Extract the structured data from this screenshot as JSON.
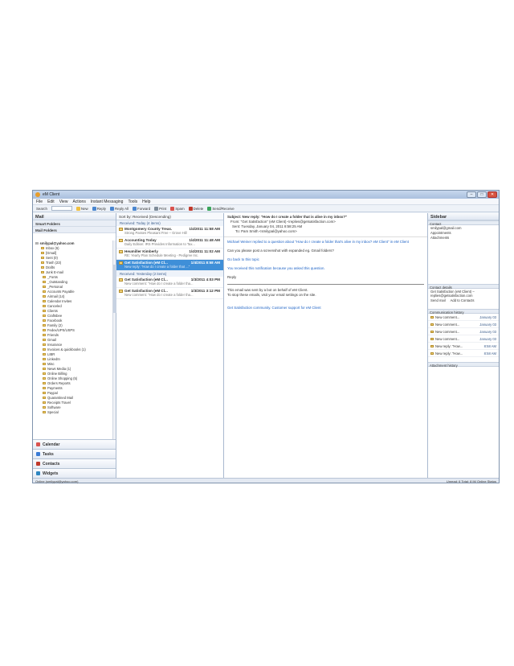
{
  "window": {
    "title": "eM Client"
  },
  "menu": [
    "File",
    "Edit",
    "View",
    "Actions",
    "Instant Messaging",
    "Tools",
    "Help"
  ],
  "toolbar": {
    "search_label": "Search",
    "buttons": [
      {
        "label": "New",
        "icon": "new-icon"
      },
      {
        "label": "Reply",
        "icon": "reply-icon"
      },
      {
        "label": "Reply All",
        "icon": "reply-all-icon"
      },
      {
        "label": "Forward",
        "icon": "forward-icon"
      },
      {
        "label": "Print",
        "icon": "print-icon"
      },
      {
        "label": "Spam",
        "icon": "spam-icon"
      },
      {
        "label": "Delete",
        "icon": "delete-icon"
      },
      {
        "label": "Send/Receive",
        "icon": "send-receive-icon"
      }
    ]
  },
  "nav": {
    "header": "Mail",
    "section_smart": "Smart Folders",
    "section_mail": "Mail Folders",
    "account": "smilypal@yahoo.com",
    "folders": [
      "Inbox (6)",
      "[Gmail]",
      "Sent (0)",
      "Trash (23)",
      "Drafts",
      "Junk E-mail",
      "_Fonts",
      "_Outstanding",
      "_Personal",
      "Accounts Payable",
      "Airmail (14)",
      "Calendar Invites",
      "Canceled",
      "Clients",
      "Craftsbee",
      "Facebook",
      "Family (2)",
      "Fedex/UPS/USPS",
      "Friends",
      "Gmail",
      "Insurance",
      "Invoices & quickbooks (1)",
      "LIBR",
      "LinkedIn",
      "Misc",
      "News Media (1)",
      "Online Billing",
      "Online Shopping (5)",
      "Orders Reports",
      "Payments",
      "Paypal",
      "Quarantined Mail",
      "Receipts Travel",
      "Software",
      "Special"
    ],
    "bottom_buttons": [
      {
        "label": "Calendar",
        "color": "#d9534f"
      },
      {
        "label": "Tasks",
        "color": "#3a7bd5"
      },
      {
        "label": "Contacts",
        "color": "#c0392b"
      },
      {
        "label": "Widgets",
        "color": "#2e86c1"
      }
    ]
  },
  "list": {
    "sort_label": "Sort by: Received (Descending)",
    "group1": "Received: Today (4 items)",
    "group2": "Received: Yesterday (2 items)",
    "messages": [
      {
        "from": "Montgomery County Treas.",
        "time": "1/4/2011 11:58 AM",
        "preview": "Strong Passes Pleasant Free – Grove Hill"
      },
      {
        "from": "Accounting Today",
        "time": "1/4/2011 11:48 AM",
        "preview": "Daily Edition: IRS Provides Information to Tax..."
      },
      {
        "from": "Heumiller Kimberly",
        "time": "1/4/2011 11:02 AM",
        "preview": "RE: Yearly Plan Schedule Meeting - Pedigree Inc."
      },
      {
        "from": "Get Satisfaction (eM Cl...",
        "time": "1/4/2011 8:58 AM",
        "preview": "New reply: \"How do I create a folder that ...\"",
        "selected": true
      },
      {
        "from": "Get Satisfaction (eM Cl...",
        "time": "1/3/2011 4:03 PM",
        "preview": "New comment: \"How do I create a folder tha..."
      },
      {
        "from": "Get Satisfaction (eM Cl...",
        "time": "1/3/2011 3:12 PM",
        "preview": "New comment: \"How do I create a folder tha..."
      }
    ]
  },
  "reader": {
    "subject": "Subject: New reply: \"How do I create a folder that is alive in my inbox?\"",
    "from": "From: \"Get Satisfaction\" (eM Client) <replies@getsatisfaction.com>",
    "sent": "Sent: Tuesday, January 04, 2011 8:58:25 AM",
    "to": "To: Pam Smith <smilypal@yahoo.com>",
    "para1": "Michael Weiner replied to a question about \"How do I create a folder that's alive in my inbox? eM Client\" in eM Client",
    "para2": "Can you please post a screenshot with expanded eg. Gmail folders?",
    "para3": "Reply",
    "link1": "Go back to this topic",
    "link2": "You received this notification because you asked this question.",
    "footer1": "This email was sent by a bot on behalf of eM Client.",
    "footer2": "To stop these emails, visit your email settings on the site.",
    "link3": "Get Satisfaction community. Customer support for eM Client"
  },
  "sidebar": {
    "header": "Sidebar",
    "contact_title": "Contact",
    "contact_email": "smilypal@gmail.com",
    "contact_lines": [
      "Appointments",
      "Attachments"
    ],
    "details_title": "Contact details",
    "details_text": "Get Satisfaction (eM Client) – replies@getsatisfaction.com",
    "send_mail": "Send mail",
    "add_contact": "Add to Contacts",
    "communication_title": "Communication history",
    "comments": [
      {
        "title": "New comment...",
        "date": "January 03"
      },
      {
        "title": "New comment...",
        "date": "January 03"
      },
      {
        "title": "New comment...",
        "date": "January 03"
      },
      {
        "title": "New comment...",
        "date": "January 03"
      },
      {
        "title": "New reply: \"How...",
        "date": "8:58 AM"
      },
      {
        "title": "New reply: \"How...",
        "date": "8:58 AM"
      }
    ],
    "attachment_title": "Attachment history"
  },
  "status": {
    "left": "Online (smilypal@yahoo.com)",
    "right": "Unread: 6   Total: 8   IM Online Status"
  }
}
